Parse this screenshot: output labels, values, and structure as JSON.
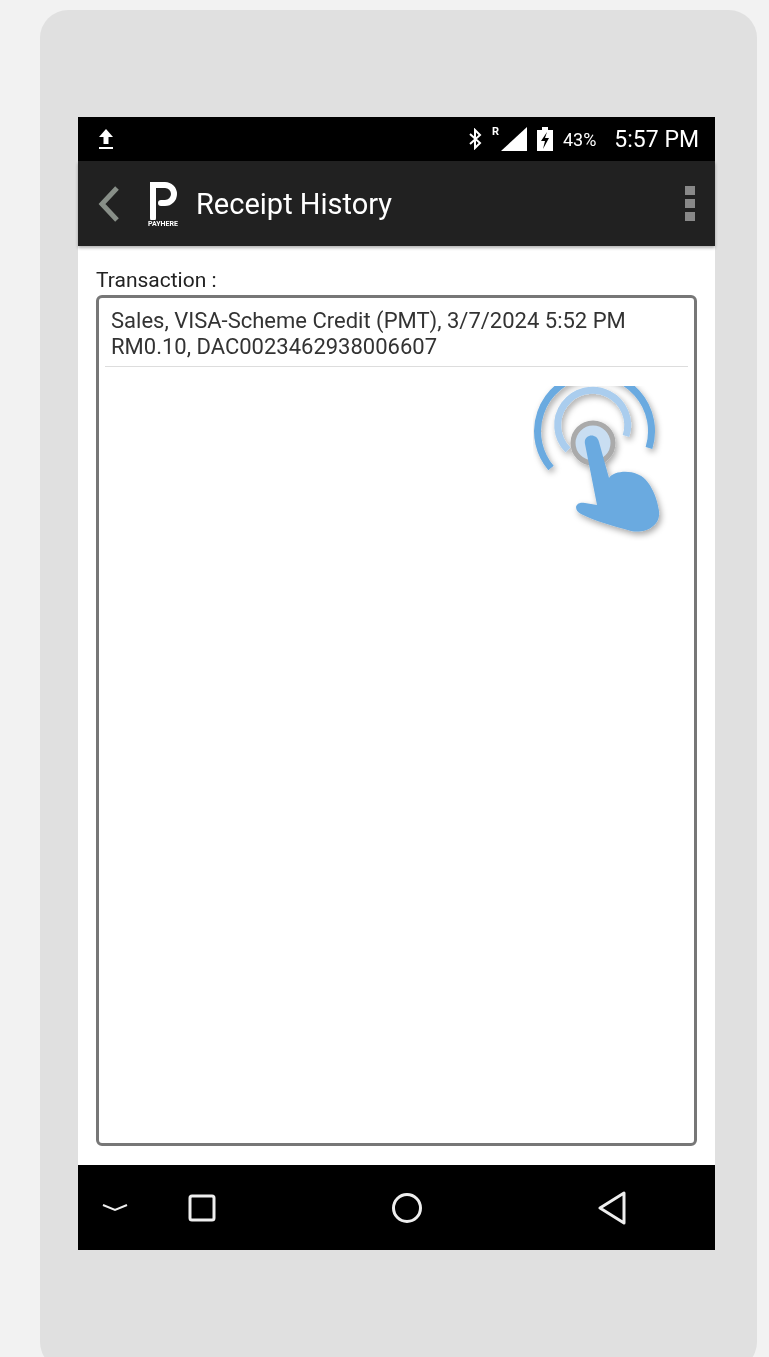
{
  "status_bar": {
    "battery": "43%",
    "time": "5:57 PM",
    "roaming": "R"
  },
  "toolbar": {
    "title": "Receipt History",
    "logo_text": "PAYHERE"
  },
  "transaction_label": "Transaction :",
  "transactions": [
    {
      "line_1": "Sales, VISA-Scheme Credit (PMT), 3/7/2024 5:52 PM",
      "line_2": "RM0.10, DAC0023462938006607"
    }
  ]
}
